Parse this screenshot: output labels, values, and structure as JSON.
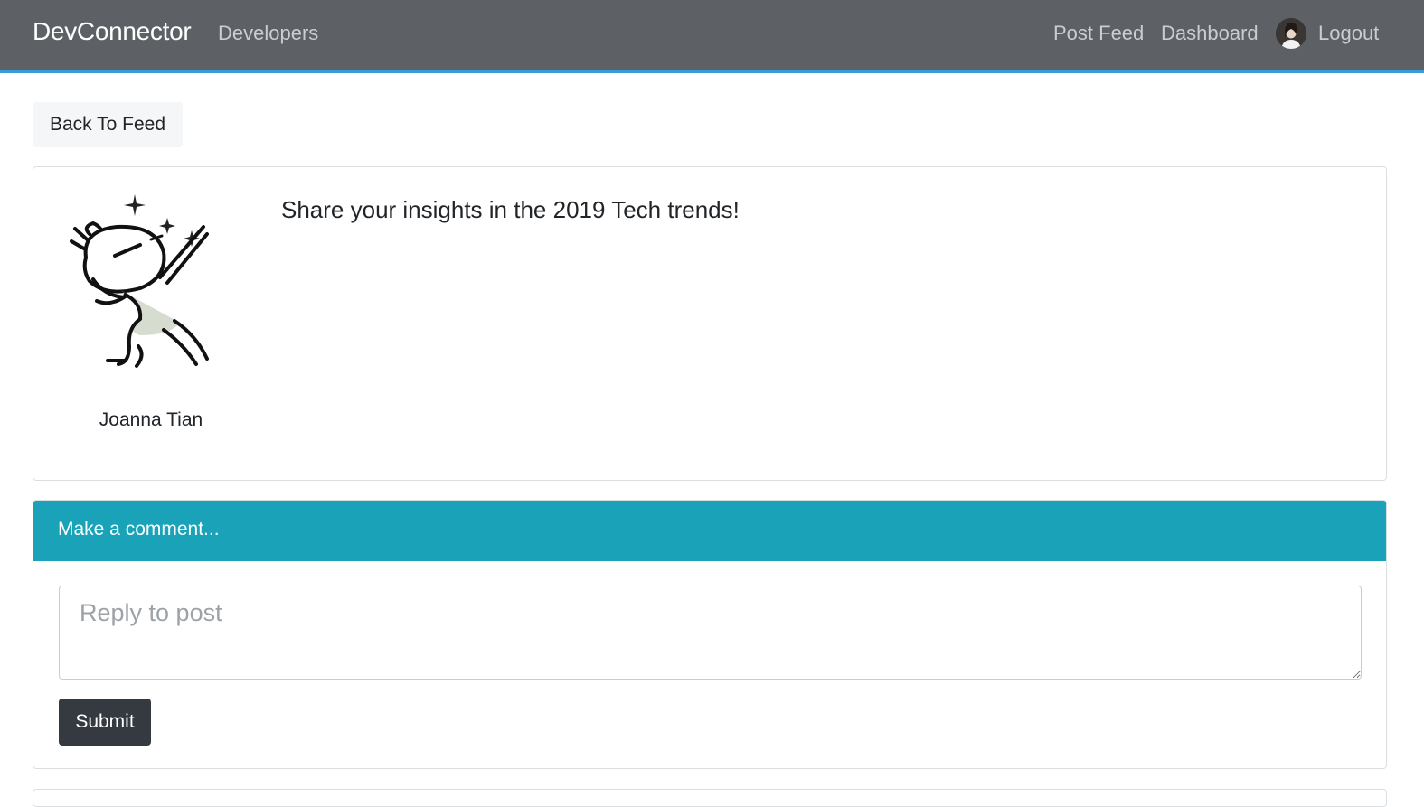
{
  "navbar": {
    "brand": "DevConnector",
    "developers_link": "Developers",
    "post_feed_link": "Post Feed",
    "dashboard_link": "Dashboard",
    "logout_link": "Logout",
    "bg_color": "#5d6166",
    "accent_border_color": "#3a9bd9"
  },
  "back_button": {
    "label": "Back To Feed"
  },
  "post": {
    "author_name": "Joanna Tian",
    "text": "Share your insights in the 2019 Tech trends!",
    "avatar_icon": "dabbing-bunny-avatar"
  },
  "comment_form": {
    "header": "Make a comment...",
    "header_color": "#19a2b8",
    "textarea_placeholder": "Reply to post",
    "textarea_value": "",
    "submit_label": "Submit",
    "submit_color": "#343a40"
  }
}
